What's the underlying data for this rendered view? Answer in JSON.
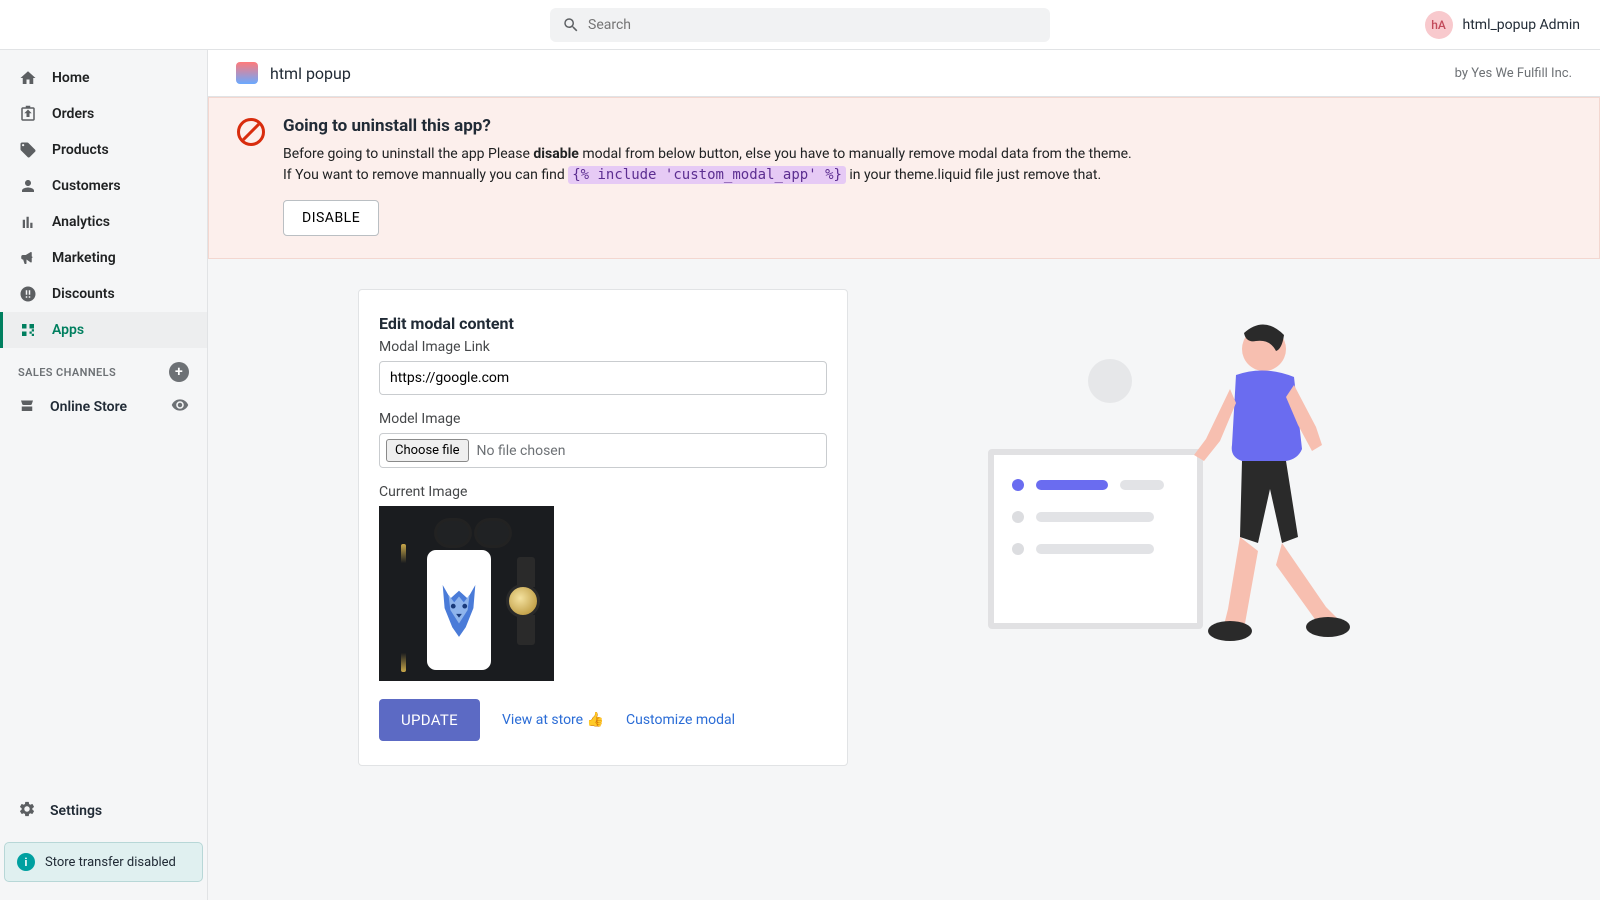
{
  "search": {
    "placeholder": "Search"
  },
  "user": {
    "initials": "hA",
    "name": "html_popup Admin"
  },
  "sidebar": {
    "items": [
      {
        "label": "Home"
      },
      {
        "label": "Orders"
      },
      {
        "label": "Products"
      },
      {
        "label": "Customers"
      },
      {
        "label": "Analytics"
      },
      {
        "label": "Marketing"
      },
      {
        "label": "Discounts"
      },
      {
        "label": "Apps"
      }
    ],
    "section_label": "SALES CHANNELS",
    "channel": "Online Store",
    "settings": "Settings",
    "transfer_notice": "Store transfer disabled"
  },
  "app": {
    "title": "html popup",
    "vendor": "by Yes We Fulfill Inc."
  },
  "warning": {
    "title": "Going to uninstall this app?",
    "line1_pre": "Before going to uninstall the app Please ",
    "line1_bold": "disable",
    "line1_post": " modal from below button, else you have to manually remove modal data from the theme.",
    "line2_pre": "If You want to remove mannually you can find ",
    "code": "{% include 'custom_modal_app' %}",
    "line2_post": " in your theme.liquid file just remove that.",
    "button": "DISABLE"
  },
  "form": {
    "heading": "Edit modal content",
    "link_label": "Modal Image Link",
    "link_value": "https://google.com",
    "image_label": "Model Image",
    "choose_label": "Choose file",
    "file_status": "No file chosen",
    "current_label": "Current Image",
    "update": "UPDATE",
    "view_link": "View at store 👍",
    "customize_link": "Customize modal"
  }
}
